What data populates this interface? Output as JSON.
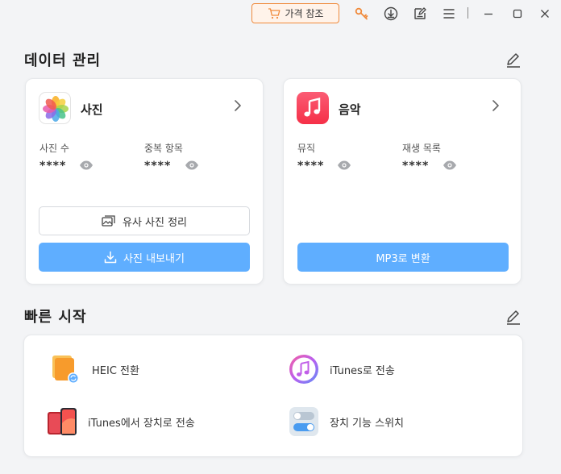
{
  "titlebar": {
    "price_button": "가격 참조",
    "icons": [
      "cart-icon",
      "key-icon",
      "download-icon",
      "feedback-icon",
      "menu-icon",
      "minimize-icon",
      "maximize-icon",
      "close-icon"
    ]
  },
  "data_management": {
    "title": "데이터 관리",
    "photos": {
      "name": "사진",
      "stat1_label": "사진 수",
      "stat1_value": "****",
      "stat2_label": "중복 항목",
      "stat2_value": "****",
      "button_secondary": "유사 사진 정리",
      "button_primary": "사진 내보내기"
    },
    "music": {
      "name": "음악",
      "stat1_label": "뮤직",
      "stat1_value": "****",
      "stat2_label": "재생 목록",
      "stat2_value": "****",
      "button_primary": "MP3로 변환"
    }
  },
  "quick_start": {
    "title": "빠른 시작",
    "items": [
      {
        "label": "HEIC 전환"
      },
      {
        "label": "iTunes로 전송"
      },
      {
        "label": "iTunes에서 장치로 전송"
      },
      {
        "label": "장치 기능 스위치"
      }
    ]
  },
  "colors": {
    "accent_blue": "#5faeff",
    "price_border": "#f08a3c",
    "background": "#f3f4f6"
  }
}
